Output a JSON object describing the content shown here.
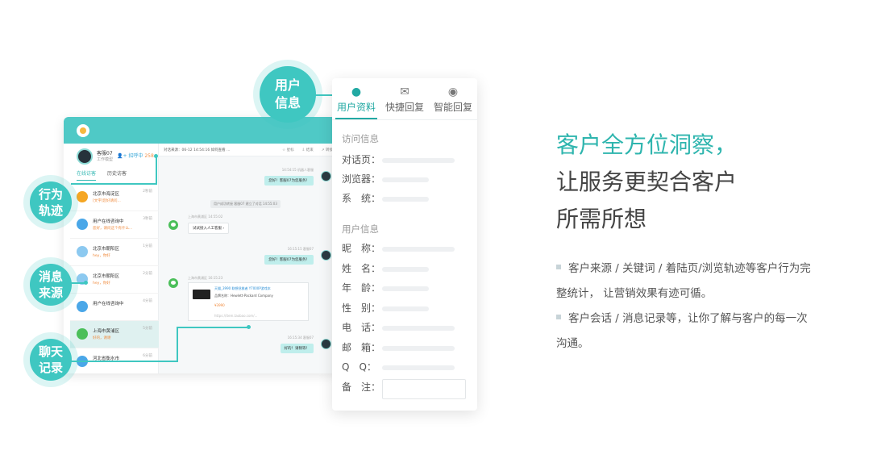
{
  "chat_window": {
    "agent_name": "客服07",
    "agent_status": "工作模型",
    "agent_add_label": "招呼中",
    "agent_add_count": "258",
    "tabs": [
      "在线访客",
      "历史访客"
    ],
    "visitors": [
      {
        "name": "北京市海淀区",
        "sub": "[文字]您好请问...",
        "time": "2秒前",
        "icon_color": "#f5a623"
      },
      {
        "name": "用户在线咨询中",
        "sub": "您好，请问这个有什么...",
        "time": "3秒前",
        "icon_color": "#4aa7e8"
      },
      {
        "name": "北京市朝阳区",
        "sub": "hey，你好",
        "time": "1分前",
        "icon_color": "#8cc9f0"
      },
      {
        "name": "北京市朝阳区",
        "sub": "hey，你好",
        "time": "2分前",
        "icon_color": "#8cc9f0"
      },
      {
        "name": "用户在线咨询中",
        "sub": "",
        "time": "4分前",
        "icon_color": "#4aa7e8"
      },
      {
        "name": "上海市黄浦区",
        "sub": "好的，谢谢",
        "time": "5分前",
        "icon_color": "#4bbf5a"
      },
      {
        "name": "河北省衡水市",
        "sub": "",
        "time": "6分前",
        "icon_color": "#4aa7e8"
      }
    ],
    "bar_text": "对话来源：06-12 14:54:16 如何查看 ...",
    "bar_tools": [
      "☆ 星标",
      "⇩ 结束",
      "↗ 转接"
    ],
    "msg1_meta": "14:54:15 机器人客服",
    "msg1": "您好！客服07为您服务！",
    "sys_msg": "用户成功转接 客服07 建立了对话 14:55:03",
    "msg2_meta": "上海市黄浦区 14:55:02",
    "msg2": "试试接入人工客服 ›",
    "msg3_meta": "16:15:15 客服07",
    "msg3": "您好！客服07为您服务！",
    "msg4_meta": "上海市黄浦区 16:15:23",
    "product_title": "天猫_3990 联想拯救者 Y7000P游戏本",
    "product_line": "品牌名称：Hewlett-Packard Company",
    "product_price": "¥3990",
    "product_url": "https://item.taobao.com/...",
    "msg5_meta": "16:15:34 客服07",
    "msg5": "好的！请稍等！"
  },
  "callouts": {
    "user_info": [
      "用户",
      "信息"
    ],
    "behavior": [
      "行为",
      "轨迹"
    ],
    "source": [
      "消息",
      "来源"
    ],
    "history": [
      "聊天",
      "记录"
    ]
  },
  "info_panel": {
    "tabs": [
      {
        "icon": "user-icon",
        "label": "用户资料",
        "active": true
      },
      {
        "icon": "quick-reply-icon",
        "label": "快捷回复",
        "active": false
      },
      {
        "icon": "smart-reply-icon",
        "label": "智能回复",
        "active": false
      }
    ],
    "visit_section": "访问信息",
    "visit_fields": [
      "对话页：",
      "浏览器：",
      "系　统："
    ],
    "user_section": "用户信息",
    "user_fields": [
      "昵　称：",
      "姓　名：",
      "年　龄：",
      "性　别：",
      "电　话：",
      "邮　箱：",
      "Q　Q：",
      "备　注："
    ]
  },
  "headline": {
    "line1": "客户全方位洞察，",
    "line2": "让服务更契合客户",
    "line3": "所需所想"
  },
  "bullets": {
    "b1_line1": "客户来源 / 关键词 / 着陆页/浏览轨迹等客户行为完",
    "b1_line2": "整统计， 让营销效果有迹可循。",
    "b2_line1": "客户会话 / 消息记录等，让你了解与客户的每一次",
    "b2_line2": "沟通。"
  },
  "colors": {
    "accent": "#3fc7c1",
    "accent_dark": "#22a9a3",
    "headline_accent": "#2eb5ae"
  }
}
